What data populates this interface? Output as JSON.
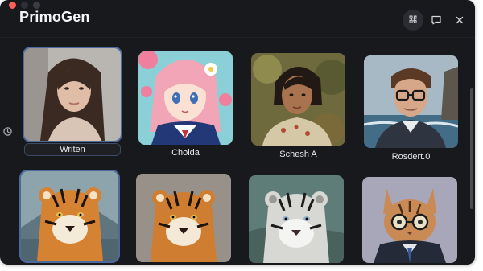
{
  "app": {
    "title": "PrimoGen"
  },
  "toolbar": {
    "icons": [
      "puzzle-icon",
      "chat-bubble-icon",
      "close-icon"
    ]
  },
  "colors": {
    "window_bg": "#17191d",
    "selection_ring": "#4c6a9c",
    "traffic_red": "#ff5f57"
  },
  "gallery": {
    "items": [
      {
        "label": "Writen",
        "selected": true
      },
      {
        "label": "Cholda"
      },
      {
        "label": "Schesh A"
      },
      {
        "label": "Rosdert.0"
      },
      {
        "label": "",
        "selected": true
      },
      {
        "label": ""
      },
      {
        "label": ""
      },
      {
        "label": ""
      }
    ]
  }
}
